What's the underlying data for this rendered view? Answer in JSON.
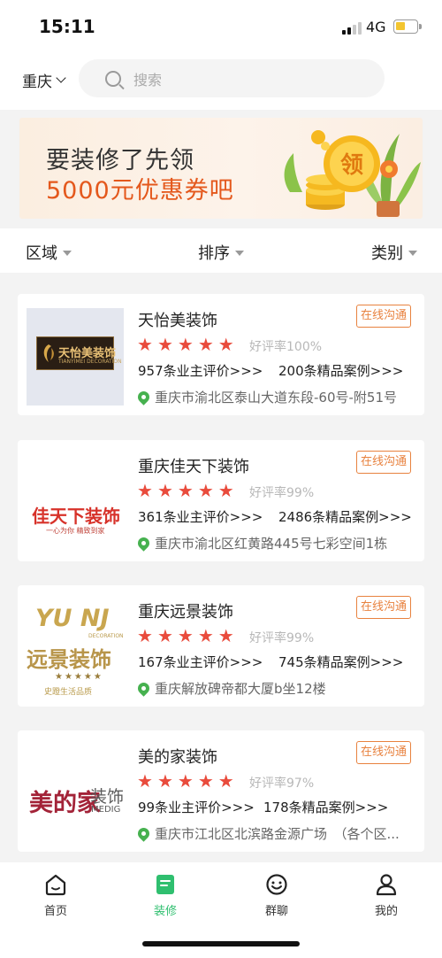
{
  "status_bar": {
    "time": "15:11",
    "network": "4G"
  },
  "header": {
    "city": "重庆",
    "search_placeholder": "搜索"
  },
  "banner": {
    "line1": "要装修了先领",
    "line2": "5000元优惠券吧",
    "coin_text": "领"
  },
  "filters": [
    {
      "label": "区域"
    },
    {
      "label": "排序"
    },
    {
      "label": "类别"
    }
  ],
  "companies": [
    {
      "name": "天怡美装饰",
      "logo_text": "天怡美装饰",
      "logo_sub": "TIANYIMEI DECORATION",
      "rating": "好评率100%",
      "reviews": "957条业主评价>>>",
      "cases": "200条精品案例>>>",
      "address": "重庆市渝北区泰山大道东段-60号-附51号",
      "chat_label": "在线沟通"
    },
    {
      "name": "重庆佳天下装饰",
      "logo_text": "佳天下装饰",
      "logo_sub": "一心为你 精致到家",
      "rating": "好评率99%",
      "reviews": "361条业主评价>>>",
      "cases": "2486条精品案例>>>",
      "address": "重庆市渝北区红黄路445号七彩空间1栋",
      "chat_label": "在线沟通"
    },
    {
      "name": "重庆远景装饰",
      "logo_text": "远景装饰",
      "logo_top": "YU NJ",
      "logo_top_sub": "DECORATION",
      "logo_stars": "★★★★★",
      "logo_sub": "史蹬生活品质",
      "rating": "好评率99%",
      "reviews": "167条业主评价>>>",
      "cases": "745条精品案例>>>",
      "address": "重庆解放碑帝都大厦b坐12楼",
      "chat_label": "在线沟通"
    },
    {
      "name": "美的家装饰",
      "logo_text": "美的家",
      "logo_side": "装饰",
      "logo_side_sub": "MEDIG",
      "rating": "好评率97%",
      "reviews": "99条业主评价>>>",
      "cases": "178条精品案例>>>",
      "address": "重庆市江北区北滨路金源广场　（各个区...",
      "chat_label": "在线沟通"
    }
  ],
  "bottom_nav": [
    {
      "label": "首页",
      "icon": "home-icon"
    },
    {
      "label": "装修",
      "icon": "document-icon",
      "active": true
    },
    {
      "label": "群聊",
      "icon": "smile-chat-icon"
    },
    {
      "label": "我的",
      "icon": "person-icon"
    }
  ],
  "colors": {
    "accent_green": "#2fbf6f",
    "star_red": "#e94b3c",
    "chat_orange": "#e8823f",
    "banner_orange": "#e4581c"
  }
}
